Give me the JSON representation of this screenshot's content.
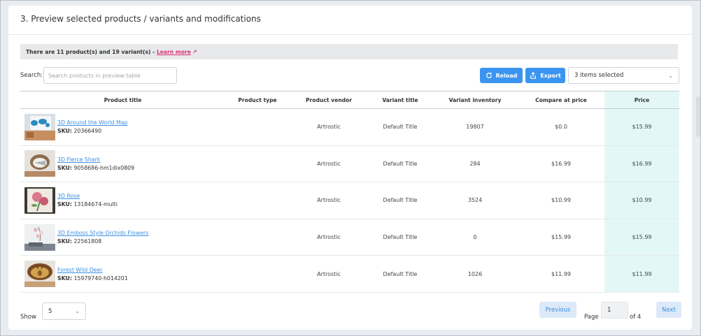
{
  "section_title": "3. Preview selected products / variants and modifications",
  "info_bar": {
    "text": "There are 11 product(s) and 19 variant(s) - ",
    "link": "Learn more"
  },
  "search": {
    "label": "Search:",
    "placeholder": "Search products in preview table"
  },
  "toolbar": {
    "reload_label": "Reload",
    "export_label": "Export",
    "selection_value": "3 items selected"
  },
  "table": {
    "columns": [
      "Product title",
      "Product type",
      "Product vendor",
      "Variant title",
      "Variant inventory",
      "Compare at price",
      "Price"
    ],
    "sku_prefix": "SKU:",
    "rows": [
      {
        "title": "3D Around the World Map",
        "sku": "20366490",
        "type": "",
        "vendor": "Artrostic",
        "variant": "Default Title",
        "inventory": "19807",
        "compare": "$0.0",
        "price": "$15.99",
        "thumb": "world-map"
      },
      {
        "title": "3D Fierce Shark",
        "sku": "9058686-hm1dix0809",
        "type": "",
        "vendor": "Artrostic",
        "variant": "Default Title",
        "inventory": "284",
        "compare": "$16.99",
        "price": "$16.99",
        "thumb": "shark"
      },
      {
        "title": "3D Rose",
        "sku": "13184674-multi",
        "type": "",
        "vendor": "Artrostic",
        "variant": "Default Title",
        "inventory": "3524",
        "compare": "$10.99",
        "price": "$10.99",
        "thumb": "rose"
      },
      {
        "title": "3D Emboss Style Orchids Flowers",
        "sku": "22561808",
        "type": "",
        "vendor": "Artrostic",
        "variant": "Default Title",
        "inventory": "0",
        "compare": "$15.99",
        "price": "$15.99",
        "thumb": "orchids"
      },
      {
        "title": "Forest Wild Deer",
        "sku": "15979740-h014201",
        "type": "",
        "vendor": "Artrostic",
        "variant": "Default Title",
        "inventory": "1026",
        "compare": "$11.99",
        "price": "$11.99",
        "thumb": "deer"
      }
    ]
  },
  "pagination": {
    "show_label": "Show",
    "page_size": "5",
    "previous_label": "Previous",
    "page_label": "Page",
    "current_page": "1",
    "of_label": "of 4",
    "next_label": "Next"
  },
  "colors": {
    "primary": "#3b95f0",
    "link": "#3b8fe3",
    "learn_more": "#d6357a",
    "price_column_bg": "#e3f8f6"
  }
}
